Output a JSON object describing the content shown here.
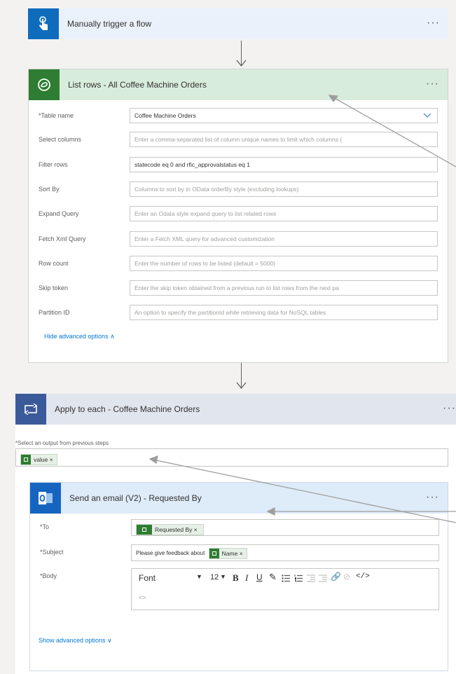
{
  "trigger": {
    "title": "Manually trigger a flow",
    "more": "···"
  },
  "list_rows": {
    "title": "List rows - All Coffee Machine Orders",
    "more": "···",
    "fields": [
      {
        "label": "*Table name",
        "value": "Coffee Machine Orders",
        "placeholder": ""
      },
      {
        "label": "Select columns",
        "value": "",
        "placeholder": "Enter a comma-separated list of column unique names to limit which columns ("
      },
      {
        "label": "Filter rows",
        "value": "statecode eq 0 and rfic_approvalstatus eq 1",
        "placeholder": ""
      },
      {
        "label": "Sort By",
        "value": "",
        "placeholder": "Columns to sort by in OData orderBy style (excluding lookups)"
      },
      {
        "label": "Expand Query",
        "value": "",
        "placeholder": "Enter an Odata style expand query to list related rows"
      },
      {
        "label": "Fetch Xml Query",
        "value": "",
        "placeholder": "Enter a Fetch XML query for advanced customization"
      },
      {
        "label": "Row count",
        "value": "",
        "placeholder": "Enter the number of rows to be listed (default = 5000)"
      },
      {
        "label": "Skip token",
        "value": "",
        "placeholder": "Enter the skip token obtained from a previous run to list rows from the next pa"
      },
      {
        "label": "Partition ID",
        "value": "",
        "placeholder": "An option to specify the partitionId while retrieving data for NoSQL tables"
      }
    ],
    "hide_advanced": "Hide advanced options ∧"
  },
  "apply_each": {
    "title": "Apply to each - Coffee Machine Orders",
    "more": "···",
    "select_label": "*Select an output from previous steps",
    "token": "value ×"
  },
  "send_email": {
    "title": "Send an email (V2) - Requested By",
    "more": "···",
    "to_label": "*To",
    "to_token": "Requested By ×",
    "subject_label": "*Subject",
    "subject_prefix": "Please give feedback about",
    "subject_token": "Name ×",
    "body_label": "*Body",
    "font": "Font",
    "font_size": "12",
    "body_placeholder": "<>",
    "show_advanced": "Show advanced options ∨"
  }
}
